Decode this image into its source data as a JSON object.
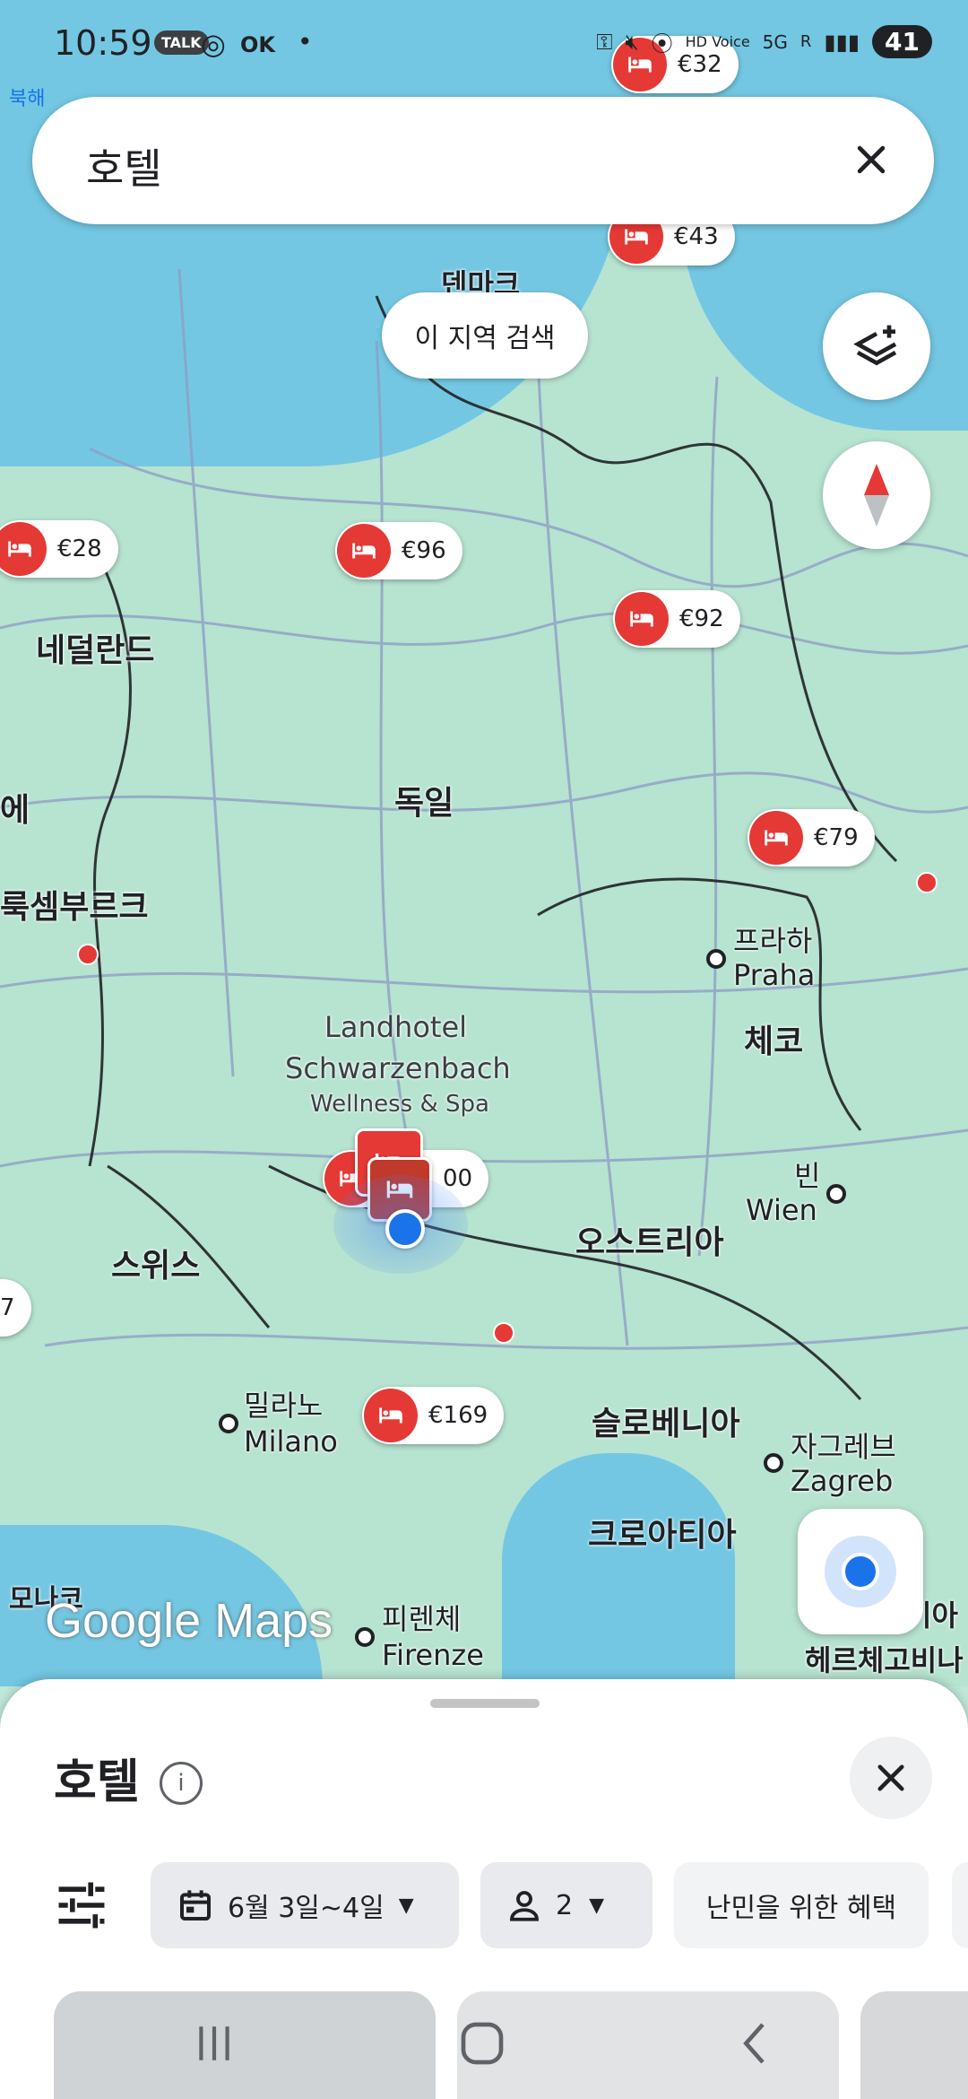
{
  "status_bar": {
    "time": "10:59",
    "notif_talk": "TALK",
    "notif_ok": "OK",
    "hd_voice": "HD Voice",
    "network": "5G",
    "roaming": "R",
    "battery": "41"
  },
  "map": {
    "north_sea_label": "북해",
    "labels": {
      "denmark": "덴마크",
      "netherlands": "네덜란드",
      "germany": "독일",
      "belgium_partial": "에",
      "luxembourg": "룩셈부르크",
      "prague_ko": "프라하",
      "prague": "Praha",
      "czech": "체코",
      "hotel_name_1": "Landhotel",
      "hotel_name_2": "Schwarzenbach",
      "hotel_name_3": "Wellness & Spa",
      "vienna_ko": "빈",
      "vienna": "Wien",
      "austria": "오스트리아",
      "switzerland": "스위스",
      "milan_ko": "밀라노",
      "milan": "Milano",
      "slovenia": "슬로베니아",
      "zagreb_ko": "자그레브",
      "zagreb": "Zagreb",
      "croatia": "크로아티아",
      "monaco": "모나코",
      "florence_ko": "피렌체",
      "florence": "Firenze",
      "bosnia": "헤르체고비나",
      "bosnia_top": "이아"
    },
    "prices": {
      "p32": "€32",
      "p43": "€43",
      "p28": "€28",
      "p96": "€96",
      "p92": "€92",
      "p79": "€79",
      "p169": "€169",
      "p00": "00",
      "p_partial": "7"
    },
    "search_this_area": "이 지역 검색",
    "watermark": "Google Maps"
  },
  "search": {
    "query": "호텔"
  },
  "sheet": {
    "title": "호텔",
    "filters": {
      "dates": "6월 3일~4일",
      "guests": "2",
      "refugee_benefits": "난민을 위한 혜택"
    }
  }
}
